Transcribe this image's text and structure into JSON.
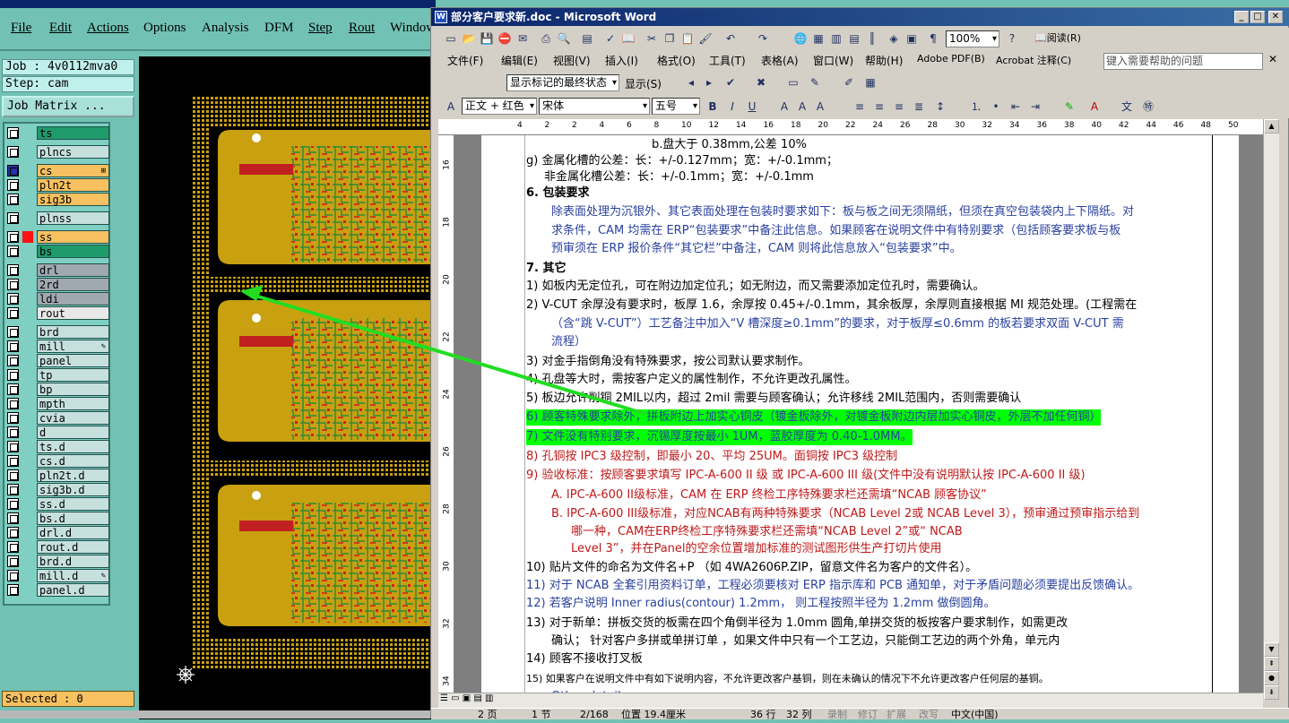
{
  "cam": {
    "menu": [
      "File",
      "Edit",
      "Actions",
      "Options",
      "Analysis",
      "DFM",
      "Step",
      "Rout",
      "Window"
    ],
    "job": "Job : 4v0112mva0",
    "step": "Step: cam",
    "job_matrix": "Job Matrix ...",
    "layers": [
      {
        "name": "ts",
        "color": "#1f9b6b",
        "mark": ""
      },
      {
        "name": "plncs",
        "color": "#c6e0de",
        "mark": ""
      },
      {
        "name": "cs",
        "color": "#f7c060",
        "mark": "⊞",
        "selected": true
      },
      {
        "name": "pln2t",
        "color": "#f7c060",
        "mark": ""
      },
      {
        "name": "sig3b",
        "color": "#f7c060",
        "mark": ""
      },
      {
        "name": "plnss",
        "color": "#c6e0de",
        "mark": ""
      },
      {
        "name": "ss",
        "color": "#f7c060",
        "mark": "",
        "swatch": "#ff1010"
      },
      {
        "name": "bs",
        "color": "#1f9b6b",
        "mark": ""
      },
      {
        "name": "drl",
        "color": "#a0a8b0",
        "mark": ""
      },
      {
        "name": "2rd",
        "color": "#a0a8b0",
        "mark": ""
      },
      {
        "name": "ldi",
        "color": "#a0a8b0",
        "mark": ""
      },
      {
        "name": "rout",
        "color": "#e8e8e8",
        "mark": ""
      },
      {
        "name": "brd",
        "color": "#c6e0de",
        "mark": ""
      },
      {
        "name": "mill",
        "color": "#c6e0de",
        "mark": "✎"
      },
      {
        "name": "panel",
        "color": "#c6e0de",
        "mark": ""
      },
      {
        "name": "tp",
        "color": "#c6e0de",
        "mark": ""
      },
      {
        "name": "bp",
        "color": "#c6e0de",
        "mark": ""
      },
      {
        "name": "mpth",
        "color": "#c6e0de",
        "mark": ""
      },
      {
        "name": "cvia",
        "color": "#c6e0de",
        "mark": ""
      },
      {
        "name": "d",
        "color": "#c6e0de",
        "mark": ""
      },
      {
        "name": "ts.d",
        "color": "#c6e0de",
        "mark": ""
      },
      {
        "name": "cs.d",
        "color": "#c6e0de",
        "mark": ""
      },
      {
        "name": "pln2t.d",
        "color": "#c6e0de",
        "mark": ""
      },
      {
        "name": "sig3b.d",
        "color": "#c6e0de",
        "mark": ""
      },
      {
        "name": "ss.d",
        "color": "#c6e0de",
        "mark": ""
      },
      {
        "name": "bs.d",
        "color": "#c6e0de",
        "mark": ""
      },
      {
        "name": "drl.d",
        "color": "#c6e0de",
        "mark": ""
      },
      {
        "name": "rout.d",
        "color": "#c6e0de",
        "mark": ""
      },
      {
        "name": "brd.d",
        "color": "#c6e0de",
        "mark": ""
      },
      {
        "name": "mill.d",
        "color": "#c6e0de",
        "mark": "✎"
      },
      {
        "name": "panel.d",
        "color": "#c6e0de",
        "mark": ""
      }
    ],
    "selected": "Selected : 0"
  },
  "word": {
    "title": "部分客户要求新.doc - Microsoft Word",
    "menu": [
      "文件(F)",
      "编辑(E)",
      "视图(V)",
      "插入(I)",
      "格式(O)",
      "工具(T)",
      "表格(A)",
      "窗口(W)",
      "帮助(H)",
      "Adobe PDF(B)",
      "Acrobat 注释(C)"
    ],
    "help_placeholder": "键入需要帮助的问题",
    "zoom": "100%",
    "reading": "阅读(R)",
    "markup_view": "显示标记的最终状态",
    "show_menu": "显示(S)",
    "style": "正文 + 红色",
    "font": "宋体",
    "size": "五号",
    "ruler_labels": [
      "4",
      "2",
      "2",
      "4",
      "6",
      "8",
      "10",
      "12",
      "14",
      "16",
      "18",
      "20",
      "22",
      "24",
      "26",
      "28",
      "30",
      "32",
      "34",
      "36",
      "38",
      "40",
      "42",
      "44",
      "46",
      "48",
      "50"
    ],
    "vruler_labels": [
      "16",
      "18",
      "20",
      "22",
      "24",
      "26",
      "28",
      "30",
      "32",
      "34"
    ],
    "lines": [
      {
        "text": "b.盘大于 0.38mm,公差 10%",
        "style": "",
        "indent": 190
      },
      {
        "text": "g) 金属化槽的公差：长：+/-0.127mm；宽：+/-0.1mm；",
        "style": "",
        "indent": 50
      },
      {
        "text": "非金属化槽公差：长：+/-0.1mm；宽：+/-0.1mm",
        "style": "",
        "indent": 70
      },
      {
        "text": "6.  包装要求",
        "style": "bold",
        "indent": 50
      },
      {
        "text": "除表面处理为沉银外、其它表面处理在包装时要求如下：板与板之间无须隔纸，但须在真空包装袋内上下隔纸。对",
        "style": "blue",
        "indent": 78
      },
      {
        "text": "求条件，CAM 均需在 ERP“包装要求”中备注此信息。如果顾客在说明文件中有特别要求（包括顾客要求板与板",
        "style": "blue",
        "indent": 78
      },
      {
        "text": "预审须在 ERP 报价条件“其它栏”中备注，CAM 则将此信息放入“包装要求”中。",
        "style": "blue",
        "indent": 78
      },
      {
        "text": "7.  其它",
        "style": "bold",
        "indent": 50
      },
      {
        "text": "1)  如板内无定位孔，可在附边加定位孔；如无附边，而又需要添加定位孔时，需要确认。",
        "style": "",
        "indent": 50
      },
      {
        "text": "2)  V-CUT 余厚没有要求时，板厚 1.6，余厚按 0.45+/-0.1mm，其余板厚，余厚则直接根据 MI 规范处理。(工程需在",
        "style": "",
        "indent": 50
      },
      {
        "text": "（含“跳 V-CUT”）工艺备注中加入“V 槽深度≥0.1mm”的要求，对于板厚≤0.6mm 的板若要求双面 V-CUT 需",
        "style": "blue",
        "indent": 78
      },
      {
        "text": "流程）",
        "style": "blue",
        "indent": 78
      },
      {
        "text": "3)  对金手指倒角没有特殊要求，按公司默认要求制作。",
        "style": "",
        "indent": 50
      },
      {
        "text": "4)  孔盘等大时，需按客户定义的属性制作，不允许更改孔属性。",
        "style": "",
        "indent": 50
      },
      {
        "text": "5)  板边允许削铜 2MIL以内，超过 2mil 需要与顾客确认；允许移线 2MIL范围内，否则需要确认",
        "style": "",
        "indent": 50
      },
      {
        "text": "6)  顾客特殊要求除外，拼板附边上加实心铜皮（镀金板除外，对镀金板附边内层加实心铜皮，外层不加任何铜）",
        "style": "hl",
        "indent": 50
      },
      {
        "text": "7)  文件没有特别要求，沉锡厚度按最小 1UM，蓝胶厚度为 0.40-1.0MM。",
        "style": "hl",
        "indent": 50
      },
      {
        "text": "8)  孔铜按 IPC3 级控制，即最小 20、平均 25UM。面铜按 IPC3 级控制",
        "style": "red",
        "indent": 50
      },
      {
        "text": "9)  验收标准：按顾客要求填写 IPC-A-600 II 级 或 IPC-A-600 III 级(文件中没有说明默认按 IPC-A-600 II 级)",
        "style": "red",
        "indent": 50
      },
      {
        "text": "A.  IPC-A-600 II级标准，CAM 在 ERP 终检工序特殊要求栏还需填“NCAB 顾客协议”",
        "style": "red",
        "indent": 78
      },
      {
        "text": "B.  IPC-A-600 III级标准，对应NCAB有两种特殊要求（NCAB Level 2或 NCAB Level 3），预审通过预审指示给到",
        "style": "red",
        "indent": 78
      },
      {
        "text": "哪一种，CAM在ERP终检工序特殊要求栏还需填“NCAB Level 2”或“ NCAB",
        "style": "red",
        "indent": 100
      },
      {
        "text": "Level 3”，并在Panel的空余位置增加标准的测试图形供生产打切片使用",
        "style": "red",
        "indent": 100
      },
      {
        "text": "10) 贴片文件的命名为文件名+P （如 4WA2606P.ZIP，留意文件名为客户的文件名）。",
        "style": "",
        "indent": 50
      },
      {
        "text": "11) 对于 NCAB 全套引用资料订单，工程必须要核对 ERP 指示库和 PCB 通知单，对于矛盾问题必须要提出反馈确认。",
        "style": "blue",
        "indent": 50
      },
      {
        "text": "12) 若客户说明 Inner radius(contour) 1.2mm，   则工程按照半径为 1.2mm 做倒圆角。",
        "style": "blue",
        "indent": 50
      },
      {
        "text": "13) 对于新单：拼板交货的板需在四个角倒半径为  1.0mm 圆角,单拼交货的板按客户要求制作，如需更改",
        "style": "",
        "indent": 50
      },
      {
        "text": "确认；  针对客户多拼或单拼订单 ，如果文件中只有一个工艺边，只能倒工艺边的两个外角，单元内",
        "style": "",
        "indent": 78
      },
      {
        "text": "14) 顾客不接收打叉板",
        "style": "",
        "indent": 50
      },
      {
        "text": "15) 如果客户在说明文件中有如下说明内容，不允许更改客户基铜，则在未确认的情况下不允许更改客户任何层的基铜。",
        "style": "small",
        "indent": 50
      },
      {
        "text": "   Other details:",
        "style": "blue",
        "indent": 78
      }
    ],
    "status": [
      "2 页",
      "1 节",
      "2/168",
      "位置 19.4厘米",
      "36 行",
      "32 列",
      "录制",
      "修订",
      "扩展",
      "改写",
      "中文(中国)"
    ]
  },
  "colors": {
    "highlight": "#00ff00",
    "arrow": "#22dd22",
    "board": "#c8a010"
  }
}
